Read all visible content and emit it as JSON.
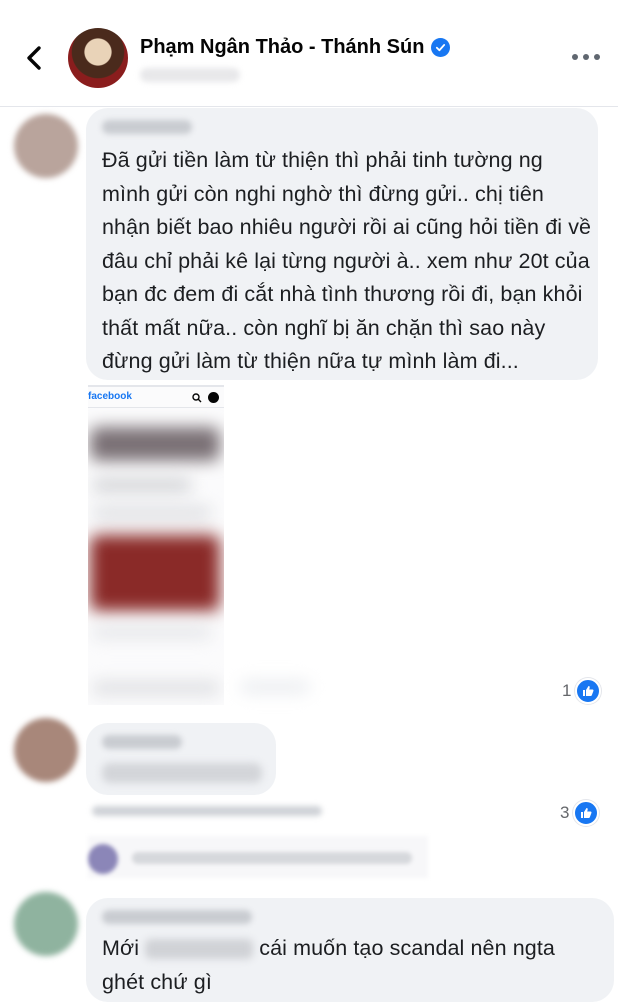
{
  "header": {
    "page_name": "Phạm Ngân Thảo - Thánh Sún",
    "verified": true,
    "back_icon": "chevron-left-icon",
    "more_icon": "more-horizontal-icon"
  },
  "comments": [
    {
      "text": "Đã gửi tiền làm từ thiện thì phải tinh tường ng mình gửi còn nghi nghờ thì đừng gửi.. chị tiên nhận biết bao nhiêu người rồi ai cũng hỏi tiền đi về đâu chỉ phải kê lại từng người à.. xem như 20t của bạn đc đem đi cắt nhà tình thương rồi đi, bạn khỏi thất mất nữa.. còn nghĩ bị ăn chặn thì sao này đừng gửi làm từ thiện nữa tự mình làm đi..."
    },
    {
      "attachment_brand": "facebook",
      "reaction_count": "1"
    },
    {
      "reaction_count": "3"
    },
    {
      "text_prefix": "Mới",
      "text_suffix": "cái muốn tạo scandal nên ngta ghét chứ gì"
    }
  ],
  "colors": {
    "accent": "#1877f2",
    "bubble": "#f0f2f5",
    "muted_text": "#65676b"
  }
}
